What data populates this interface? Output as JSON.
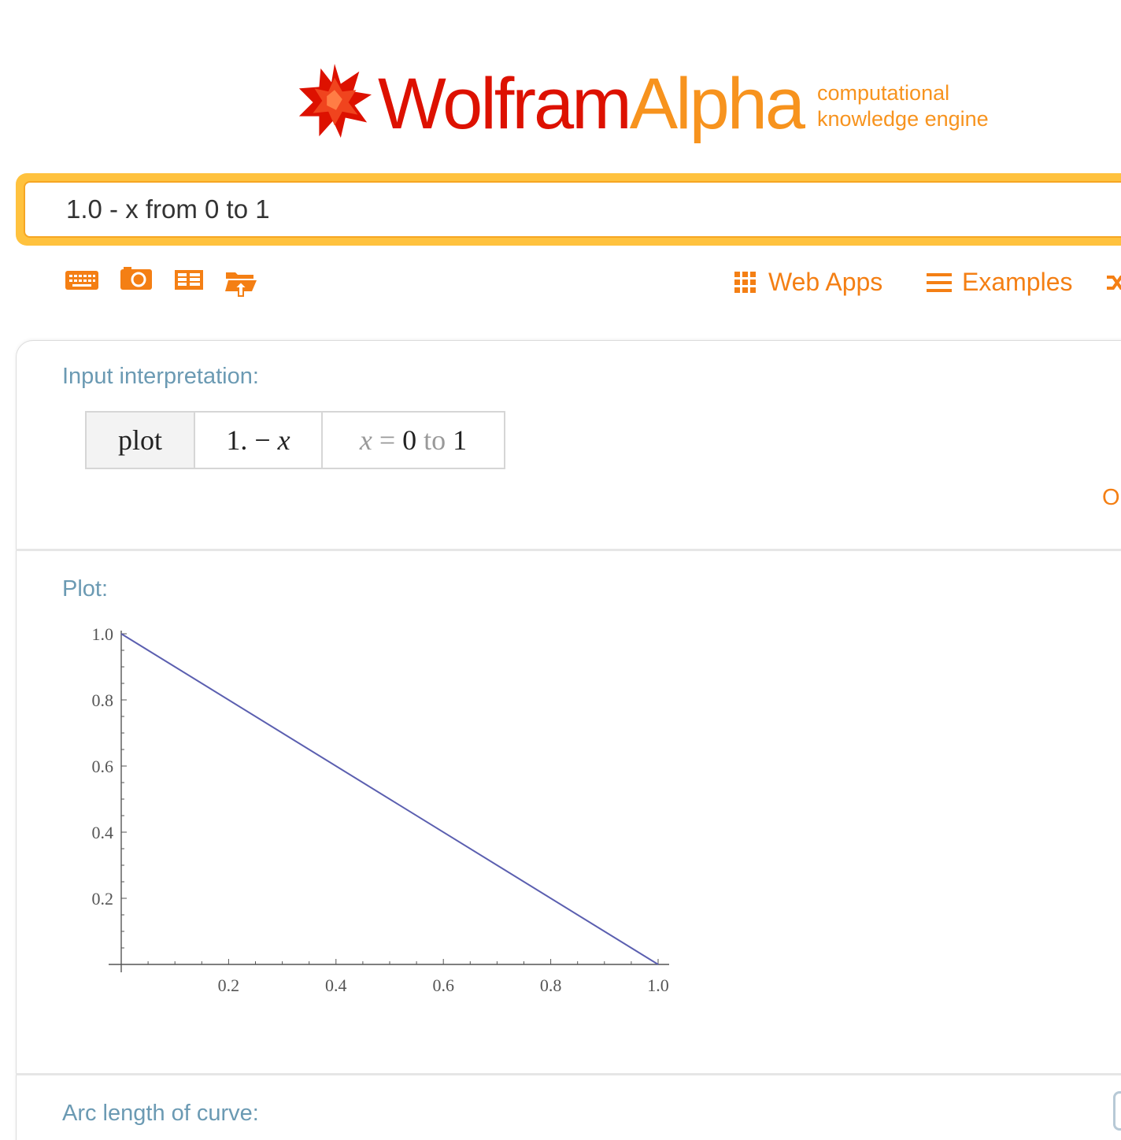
{
  "header": {
    "logo_word_part1": "Wolfram",
    "logo_word_part2": "Alpha",
    "tagline_line1": "computational",
    "tagline_line2": "knowledge engine",
    "brand_red": "#dd1100",
    "brand_orange": "#f7931e"
  },
  "search": {
    "value": "1.0 - x from 0 to 1"
  },
  "toolbar": {
    "icons": [
      "keyboard-icon",
      "camera-icon",
      "table-icon",
      "file-upload-icon"
    ],
    "web_apps_label": "Web Apps",
    "examples_label": "Examples",
    "accent": "#f47f14"
  },
  "pods": {
    "input_interpretation": {
      "title": "Input interpretation:",
      "cells": {
        "command": "plot",
        "expr_number": "1. −",
        "expr_var": "x",
        "range_var": "x",
        "range_eq": " = ",
        "range_from": "0",
        "range_to_word": " to ",
        "range_to": "1"
      },
      "option_link": "Op"
    },
    "plot": {
      "title": "Plot:"
    },
    "arc_length": {
      "title": "Arc length of curve:"
    }
  },
  "chart_data": {
    "type": "line",
    "series": [
      {
        "x": [
          0.0,
          1.0
        ],
        "y": [
          1.0,
          0.0
        ],
        "color": "#5b5fb0"
      }
    ],
    "xticks": [
      "0.2",
      "0.4",
      "0.6",
      "0.8",
      "1.0"
    ],
    "yticks": [
      "0.2",
      "0.4",
      "0.6",
      "0.8",
      "1.0"
    ],
    "xlim": [
      0,
      1
    ],
    "ylim": [
      0,
      1
    ],
    "grid": false
  }
}
